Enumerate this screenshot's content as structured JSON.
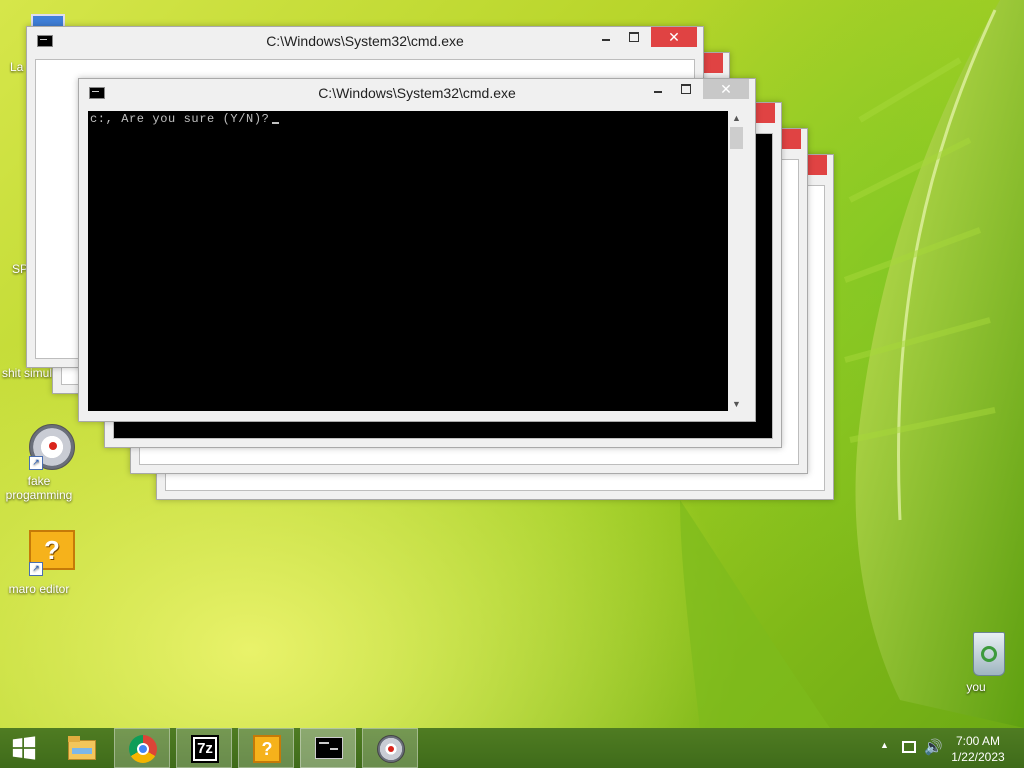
{
  "desktop": {
    "icons": [
      {
        "label": "La",
        "name": "laptop-icon"
      },
      {
        "label": "",
        "name": "shortcut-icon-2"
      },
      {
        "label": "SP",
        "name": "chrome-shortcut-icon"
      },
      {
        "label": "shit simul",
        "name": "simulator-icon"
      },
      {
        "label": "fake progamming",
        "name": "fake-programming-icon"
      },
      {
        "label": "maro editor",
        "name": "maro-editor-icon"
      },
      {
        "label": "you",
        "name": "recycle-bin-icon"
      }
    ]
  },
  "windows": {
    "back_title": "C:\\Windows\\System32\\cmd.exe",
    "front_title": "C:\\Windows\\System32\\cmd.exe",
    "close_glyph": "✕",
    "console_text": "c:, Are you sure (Y/N)?"
  },
  "taskbar": {
    "items": [
      {
        "name": "start-button",
        "icon": "windows-logo-icon"
      },
      {
        "name": "file-explorer",
        "icon": "folder-icon"
      },
      {
        "name": "chrome",
        "icon": "chrome-icon"
      },
      {
        "name": "7zip",
        "icon": "7zip-icon",
        "label": "7z"
      },
      {
        "name": "maro-editor",
        "icon": "question-block-icon"
      },
      {
        "name": "cmd",
        "icon": "cmd-icon"
      },
      {
        "name": "fake-programming",
        "icon": "compass-icon"
      }
    ],
    "clock_time": "7:00 AM",
    "clock_date": "1/22/2023"
  },
  "colors": {
    "close_red": "#e04343",
    "taskbar_green": "#4a7620",
    "console_bg": "#000000"
  }
}
